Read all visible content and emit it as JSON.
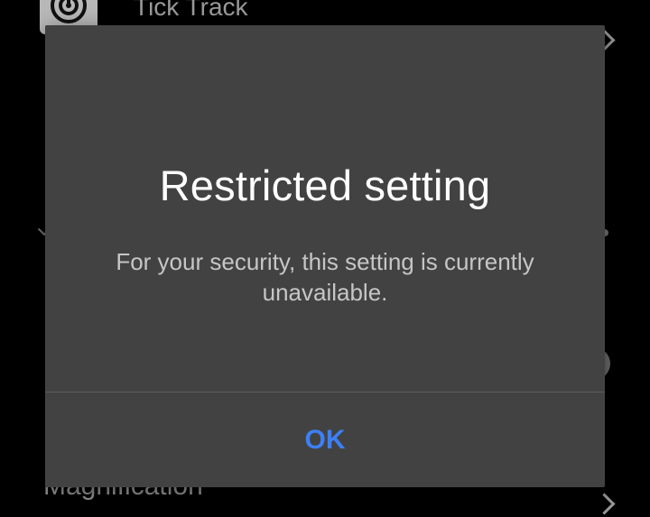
{
  "background": {
    "top_item_title": "Tick Track",
    "bottom_item_title": "Magnification"
  },
  "dialog": {
    "title": "Restricted setting",
    "message": "For your security, this setting is currently unavailable.",
    "ok_label": "OK"
  },
  "colors": {
    "dialog_bg": "#424242",
    "accent": "#3d7ff5"
  }
}
